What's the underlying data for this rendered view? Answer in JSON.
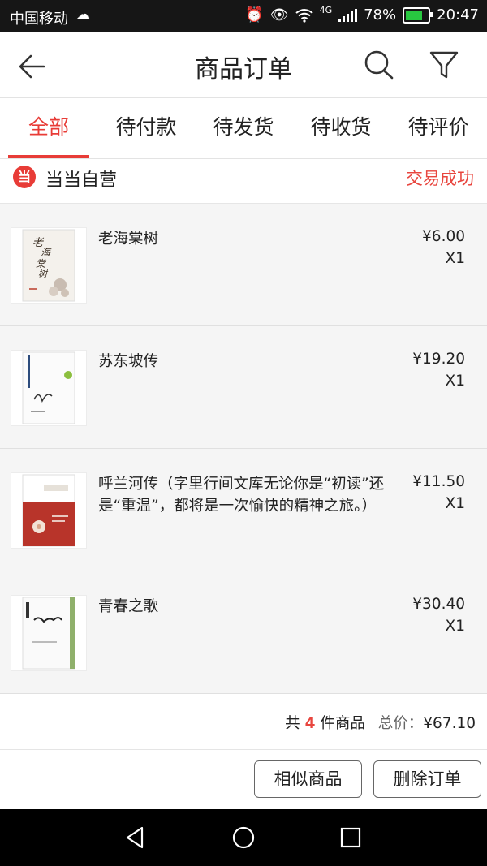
{
  "status_bar": {
    "carrier": "中国移动",
    "network": "4G",
    "battery": "78%",
    "battery_level": 0.78,
    "time": "20:47"
  },
  "header": {
    "title": "商品订单",
    "icons": [
      "back-arrow-icon",
      "search-icon",
      "filter-icon"
    ]
  },
  "tabs": [
    {
      "label": "全部",
      "active": true
    },
    {
      "label": "待付款",
      "active": false
    },
    {
      "label": "待发货",
      "active": false
    },
    {
      "label": "待收货",
      "active": false
    },
    {
      "label": "待评价",
      "active": false
    }
  ],
  "store": {
    "name": "当当自营",
    "status": "交易成功"
  },
  "items": [
    {
      "name": "老海棠树",
      "price": "¥6.00",
      "qty": "X1"
    },
    {
      "name": "苏东坡传",
      "price": "¥19.20",
      "qty": "X1"
    },
    {
      "name": "呼兰河传（字里行间文库无论你是“初读”还是“重温”，都将是一次愉快的精神之旅。）",
      "price": "¥11.50",
      "qty": "X1"
    },
    {
      "name": "青春之歌",
      "price": "¥30.40",
      "qty": "X1"
    }
  ],
  "summary": {
    "prefix": "共",
    "count": "4",
    "suffix": "件商品",
    "total_label": "总价：",
    "total_value": "¥67.10"
  },
  "buttons": {
    "similar": "相似商品",
    "delete": "删除订单"
  },
  "colors": {
    "accent": "#e83c37",
    "status_text": "#e8453e"
  }
}
